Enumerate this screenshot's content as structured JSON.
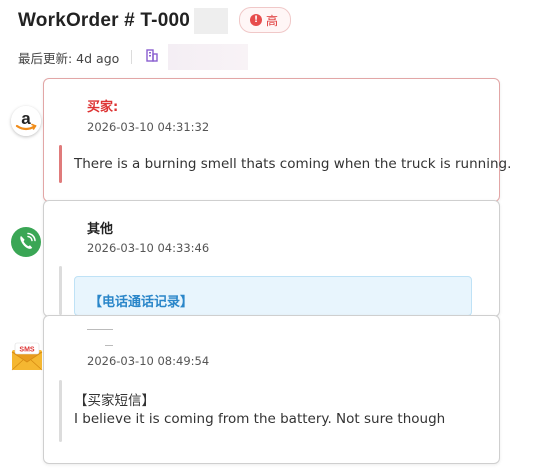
{
  "header": {
    "title": "WorkOrder # T-000",
    "priority_label": "高",
    "updated_label": "最后更新: 4d ago"
  },
  "messages": [
    {
      "channel": "amazon",
      "icon": "amazon-icon",
      "sender": "买家:",
      "timestamp": "2026-03-10 04:31:32",
      "text": "There is a burning smell thats coming when the truck is running."
    },
    {
      "channel": "phone",
      "icon": "phone-icon",
      "sender": "其他",
      "timestamp": "2026-03-10 04:33:46",
      "call_record_label": "【电话通话记录】"
    },
    {
      "channel": "sms",
      "icon": "sms-icon",
      "sms_badge": "SMS",
      "sender": "",
      "timestamp": "2026-03-10 08:49:54",
      "quote_title": "【买家短信】",
      "text": "I believe it is coming from the battery. Not sure though"
    }
  ],
  "colors": {
    "accent_red": "#d33333",
    "phone_green": "#3aa655",
    "call_blue": "#2a86c9"
  }
}
